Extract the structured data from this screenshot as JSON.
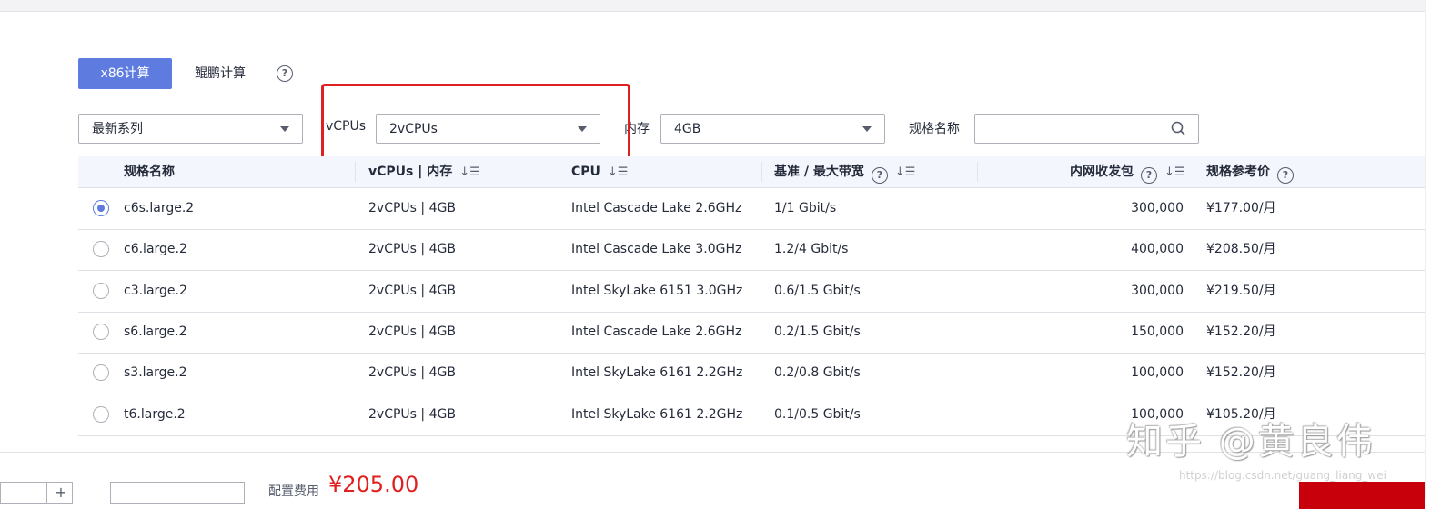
{
  "arch_tabs": {
    "x86": "x86计算",
    "kunpeng": "鲲鹏计算",
    "help": "?"
  },
  "filters": {
    "series": "最新系列",
    "vcpu_label": "vCPUs",
    "vcpu_value": "2vCPUs",
    "mem_label": "内存",
    "mem_value": "4GB",
    "name_label": "规格名称",
    "name_value": ""
  },
  "table": {
    "headers": {
      "name": "规格名称",
      "vcpu_mem": "vCPUs | 内存",
      "cpu": "CPU",
      "bandwidth": "基准 / 最大带宽",
      "pps": "内网收发包",
      "price": "规格参考价"
    },
    "sort_icon": "↓☰",
    "rows": [
      {
        "selected": true,
        "name": "c6s.large.2",
        "vcpu_mem": "2vCPUs | 4GB",
        "cpu": "Intel Cascade Lake 2.6GHz",
        "bandwidth": "1/1 Gbit/s",
        "pps": "300,000",
        "price": "¥177.00/月"
      },
      {
        "selected": false,
        "name": "c6.large.2",
        "vcpu_mem": "2vCPUs | 4GB",
        "cpu": "Intel Cascade Lake 3.0GHz",
        "bandwidth": "1.2/4 Gbit/s",
        "pps": "400,000",
        "price": "¥208.50/月"
      },
      {
        "selected": false,
        "name": "c3.large.2",
        "vcpu_mem": "2vCPUs | 4GB",
        "cpu": "Intel SkyLake 6151 3.0GHz",
        "bandwidth": "0.6/1.5 Gbit/s",
        "pps": "300,000",
        "price": "¥219.50/月"
      },
      {
        "selected": false,
        "name": "s6.large.2",
        "vcpu_mem": "2vCPUs | 4GB",
        "cpu": "Intel Cascade Lake 2.6GHz",
        "bandwidth": "0.2/1.5 Gbit/s",
        "pps": "150,000",
        "price": "¥152.20/月"
      },
      {
        "selected": false,
        "name": "s3.large.2",
        "vcpu_mem": "2vCPUs | 4GB",
        "cpu": "Intel SkyLake 6161 2.2GHz",
        "bandwidth": "0.2/0.8 Gbit/s",
        "pps": "100,000",
        "price": "¥152.20/月"
      },
      {
        "selected": false,
        "name": "t6.large.2",
        "vcpu_mem": "2vCPUs | 4GB",
        "cpu": "Intel SkyLake 6161 2.2GHz",
        "bandwidth": "0.1/0.5 Gbit/s",
        "pps": "100,000",
        "price": "¥105.20/月"
      }
    ]
  },
  "footer": {
    "stepper_plus": "+",
    "cost_label": "配置费用",
    "cost_value": "¥205.00"
  },
  "watermark": {
    "text": "知乎 @黄良伟",
    "url": "https://blog.csdn.net/guang_liang_wei"
  },
  "colors": {
    "primary": "#5e7ce0",
    "highlight_box": "#e02020",
    "price": "#e02020",
    "buy": "#c7000b"
  }
}
